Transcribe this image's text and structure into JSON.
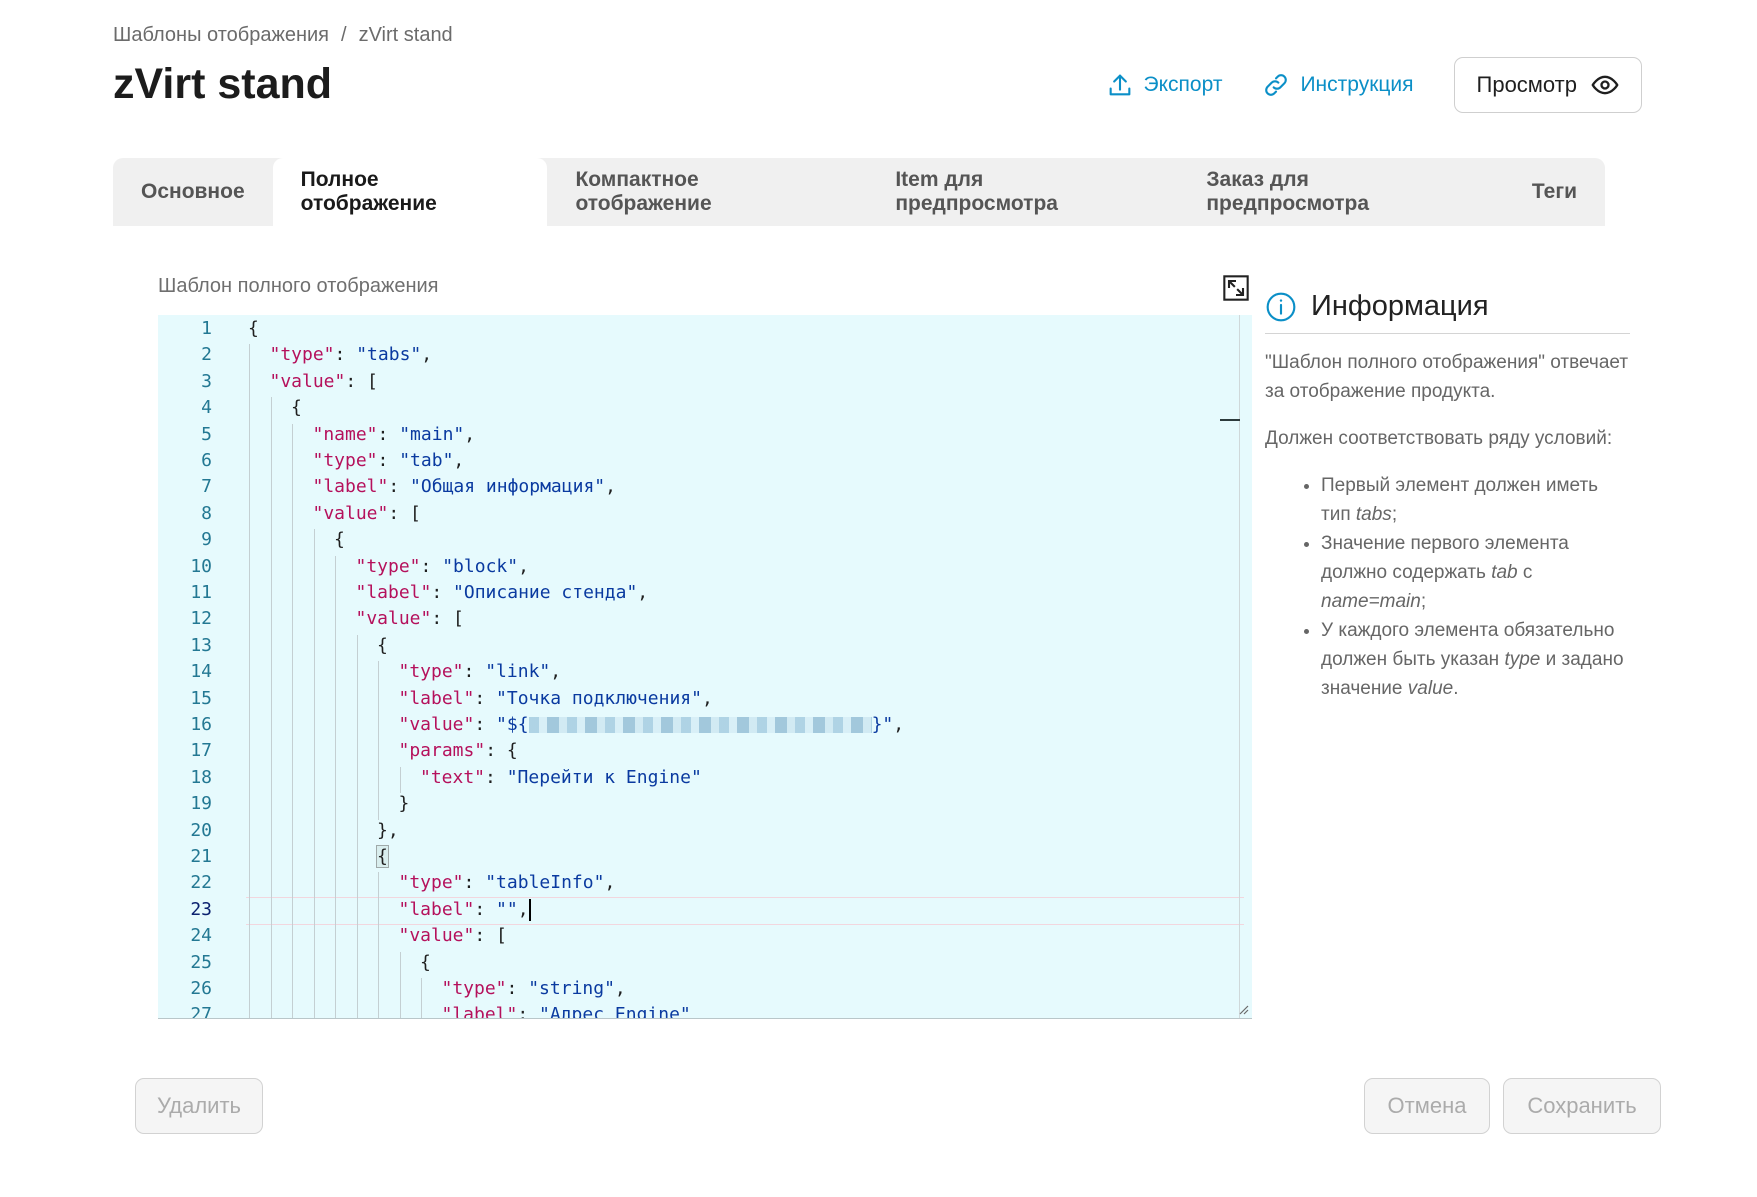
{
  "breadcrumb": {
    "parent": "Шаблоны отображения",
    "separator": "/",
    "current": "zVirt stand"
  },
  "page_title": "zVirt stand",
  "actions": {
    "export_label": "Экспорт",
    "instruction_label": "Инструкция",
    "view_label": "Просмотр"
  },
  "tabs": [
    {
      "label": "Основное"
    },
    {
      "label": "Полное отображение"
    },
    {
      "label": "Компактное отображение"
    },
    {
      "label": "Item для предпросмотра"
    },
    {
      "label": "Заказ для предпросмотра"
    },
    {
      "label": "Теги"
    }
  ],
  "active_tab": "Полное отображение",
  "editor": {
    "label": "Шаблон полного отображения",
    "active_line": 23,
    "lines": [
      {
        "n": "1",
        "d": 0,
        "p": [
          [
            "p",
            "{"
          ]
        ]
      },
      {
        "n": "2",
        "d": 1,
        "p": [
          [
            "k",
            "\"type\""
          ],
          [
            "p",
            ": "
          ],
          [
            "s",
            "\"tabs\""
          ],
          [
            "p",
            ","
          ]
        ]
      },
      {
        "n": "3",
        "d": 1,
        "p": [
          [
            "k",
            "\"value\""
          ],
          [
            "p",
            ": ["
          ]
        ]
      },
      {
        "n": "4",
        "d": 2,
        "p": [
          [
            "p",
            "{"
          ]
        ]
      },
      {
        "n": "5",
        "d": 3,
        "p": [
          [
            "k",
            "\"name\""
          ],
          [
            "p",
            ": "
          ],
          [
            "s",
            "\"main\""
          ],
          [
            "p",
            ","
          ]
        ]
      },
      {
        "n": "6",
        "d": 3,
        "p": [
          [
            "k",
            "\"type\""
          ],
          [
            "p",
            ": "
          ],
          [
            "s",
            "\"tab\""
          ],
          [
            "p",
            ","
          ]
        ]
      },
      {
        "n": "7",
        "d": 3,
        "p": [
          [
            "k",
            "\"label\""
          ],
          [
            "p",
            ": "
          ],
          [
            "s",
            "\"Общая информация\""
          ],
          [
            "p",
            ","
          ]
        ]
      },
      {
        "n": "8",
        "d": 3,
        "p": [
          [
            "k",
            "\"value\""
          ],
          [
            "p",
            ": ["
          ]
        ]
      },
      {
        "n": "9",
        "d": 4,
        "p": [
          [
            "p",
            "{"
          ]
        ]
      },
      {
        "n": "10",
        "d": 5,
        "p": [
          [
            "k",
            "\"type\""
          ],
          [
            "p",
            ": "
          ],
          [
            "s",
            "\"block\""
          ],
          [
            "p",
            ","
          ]
        ]
      },
      {
        "n": "11",
        "d": 5,
        "p": [
          [
            "k",
            "\"label\""
          ],
          [
            "p",
            ": "
          ],
          [
            "s",
            "\"Описание стенда\""
          ],
          [
            "p",
            ","
          ]
        ]
      },
      {
        "n": "12",
        "d": 5,
        "p": [
          [
            "k",
            "\"value\""
          ],
          [
            "p",
            ": ["
          ]
        ]
      },
      {
        "n": "13",
        "d": 6,
        "p": [
          [
            "p",
            "{"
          ]
        ]
      },
      {
        "n": "14",
        "d": 7,
        "p": [
          [
            "k",
            "\"type\""
          ],
          [
            "p",
            ": "
          ],
          [
            "s",
            "\"link\""
          ],
          [
            "p",
            ","
          ]
        ]
      },
      {
        "n": "15",
        "d": 7,
        "p": [
          [
            "k",
            "\"label\""
          ],
          [
            "p",
            ": "
          ],
          [
            "s",
            "\"Точка подключения\""
          ],
          [
            "p",
            ","
          ]
        ]
      },
      {
        "n": "16",
        "d": 7,
        "p": [
          [
            "k",
            "\"value\""
          ],
          [
            "p",
            ": "
          ],
          [
            "s",
            "\"${"
          ],
          [
            "blur",
            ""
          ],
          [
            "s",
            "}\""
          ],
          [
            "p",
            ","
          ]
        ]
      },
      {
        "n": "17",
        "d": 7,
        "p": [
          [
            "k",
            "\"params\""
          ],
          [
            "p",
            ": {"
          ]
        ]
      },
      {
        "n": "18",
        "d": 8,
        "p": [
          [
            "k",
            "\"text\""
          ],
          [
            "p",
            ": "
          ],
          [
            "s",
            "\"Перейти к Engine\""
          ]
        ]
      },
      {
        "n": "19",
        "d": 7,
        "p": [
          [
            "p",
            "}"
          ]
        ]
      },
      {
        "n": "20",
        "d": 6,
        "p": [
          [
            "p",
            "},"
          ]
        ]
      },
      {
        "n": "21",
        "d": 6,
        "p": [
          [
            "hl",
            "{"
          ]
        ]
      },
      {
        "n": "22",
        "d": 7,
        "p": [
          [
            "k",
            "\"type\""
          ],
          [
            "p",
            ": "
          ],
          [
            "s",
            "\"tableInfo\""
          ],
          [
            "p",
            ","
          ]
        ]
      },
      {
        "n": "23",
        "d": 7,
        "p": [
          [
            "k",
            "\"label\""
          ],
          [
            "p",
            ": "
          ],
          [
            "s",
            "\"\""
          ],
          [
            "p",
            ","
          ],
          [
            "caret",
            ""
          ]
        ]
      },
      {
        "n": "24",
        "d": 7,
        "p": [
          [
            "k",
            "\"value\""
          ],
          [
            "p",
            ": ["
          ]
        ]
      },
      {
        "n": "25",
        "d": 8,
        "p": [
          [
            "p",
            "{"
          ]
        ]
      },
      {
        "n": "26",
        "d": 9,
        "p": [
          [
            "k",
            "\"type\""
          ],
          [
            "p",
            ": "
          ],
          [
            "s",
            "\"string\""
          ],
          [
            "p",
            ","
          ]
        ]
      },
      {
        "n": "27",
        "d": 9,
        "p": [
          [
            "k",
            "\"label\""
          ],
          [
            "p",
            ": "
          ],
          [
            "s",
            "\"Адрес Engine\""
          ]
        ]
      }
    ]
  },
  "info": {
    "title": "Информация",
    "p1": "\"Шаблон полного отображения\" отвечает за отображение продукта.",
    "p2": "Должен соответствовать ряду условий:",
    "li1": {
      "a": "Первый элемент должен иметь тип ",
      "b": "tabs",
      "c": ";"
    },
    "li2": {
      "a": "Значение первого элемента должно содержать ",
      "b": "tab",
      "c": " с ",
      "d": "name=main",
      "e": ";"
    },
    "li3": {
      "a": "У каждого элемента обязательно должен быть указан ",
      "b": "type",
      "c": " и задано значение ",
      "d": "value",
      "e": "."
    }
  },
  "buttons": {
    "delete": "Удалить",
    "cancel": "Отмена",
    "save": "Сохранить"
  },
  "icons": [
    "upload-icon",
    "link-icon",
    "eye-icon",
    "expand-icon",
    "info-icon",
    "resize-handle-icon"
  ],
  "colors": {
    "accent": "#0b8fc7",
    "editor_bg": "#e6fafd",
    "json_key": "#b5115c",
    "json_string": "#0a3aa0",
    "line_number": "#237893"
  }
}
